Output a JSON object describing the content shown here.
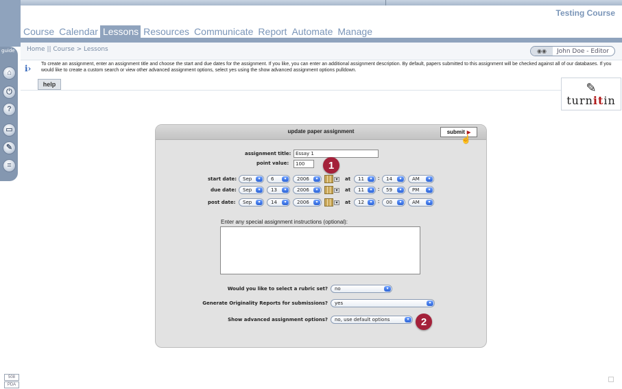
{
  "course": {
    "title": "Testing Course"
  },
  "nav": {
    "items": [
      "Course",
      "Calendar",
      "Lessons",
      "Resources",
      "Communicate",
      "Report",
      "Automate",
      "Manage"
    ],
    "active": "Lessons"
  },
  "breadcrumb": "Home || Course > Lessons",
  "user": {
    "label": "John Doe - Editor"
  },
  "sidebar": {
    "guide_label": "guide",
    "icons": [
      "home-icon",
      "power-icon",
      "help-icon",
      "folder-icon",
      "tools-icon",
      "chat-icon"
    ]
  },
  "info": {
    "text": "To create an assignment, enter an assignment title and choose the start and due dates for the assignment. If you like, you can enter an additional assignment description. By default, papers submitted to this assignment will be checked against all of our databases. If you would like to create a custom search or view other advanced assignment options, select yes using the show advanced assignment options pulldown."
  },
  "help_label": "help",
  "logo": {
    "pre": "turn",
    "mid": "it",
    "post": "in"
  },
  "panel": {
    "title": "update paper assignment",
    "submit_label": "submit",
    "title_label": "assignment title:",
    "title_value": "Essay 1",
    "points_label": "point value:",
    "points_value": "100",
    "at_label": "at",
    "dates": [
      {
        "label": "start date:",
        "month": "Sep",
        "day": "6",
        "year": "2006",
        "hour": "11",
        "minute": "14",
        "ampm": "AM"
      },
      {
        "label": "due date:",
        "month": "Sep",
        "day": "13",
        "year": "2006",
        "hour": "11",
        "minute": "59",
        "ampm": "PM"
      },
      {
        "label": "post date:",
        "month": "Sep",
        "day": "14",
        "year": "2006",
        "hour": "12",
        "minute": "00",
        "ampm": "AM"
      }
    ],
    "instructions_label": "Enter any special assignment instructions (optional):",
    "instructions_value": "",
    "questions": [
      {
        "label": "Would you like to select a rubric set?",
        "value": "no"
      },
      {
        "label": "Generate Originality Reports for submissions?",
        "value": "yes"
      },
      {
        "label": "Show advanced assignment options?",
        "value": "no, use default options"
      }
    ]
  },
  "badges": [
    "1",
    "2"
  ],
  "footer": {
    "b1": "508",
    "b2": "PDA"
  }
}
